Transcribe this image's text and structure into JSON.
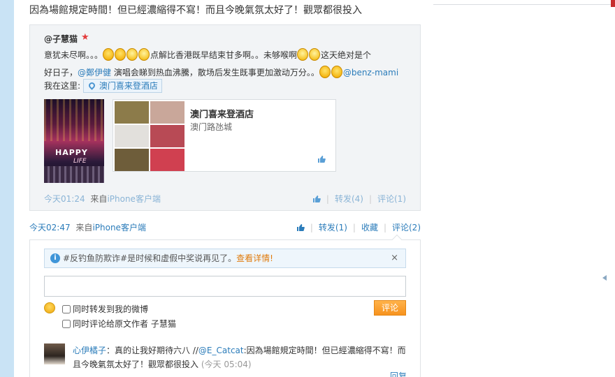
{
  "main_post": {
    "text": "因為場館規定時間！但已經濃縮得不寫！而且今晚氣氛太好了！觀眾都很投入"
  },
  "quoted_post": {
    "author": "@子慧猫",
    "line1_a": "意犹未尽啊。。。",
    "line1_b": "点解比香港既早结束甘多啊。。未够喉啊",
    "line1_c": "这天绝对是个",
    "line2_a": "好日子，",
    "mention_1": "@鄭伊健",
    "line2_b": " 演唱会睇到热血沸騰，散场后发生既事更加激动万分。。",
    "mention_2": "@benz-mami",
    "line3_prefix": "我在这里:",
    "location_chip": "澳门喜来登酒店",
    "place_card": {
      "name": "澳门喜来登酒店",
      "address": "澳门路氹城"
    },
    "concert_photo": {
      "text_happy": "HAPPY",
      "text_life": "LIFE"
    },
    "time": "今天01:24",
    "source_prefix": "来自",
    "source": "iPhone客户端",
    "forward": "转发(4)",
    "comment": "评论(1)"
  },
  "main_footer": {
    "time": "今天02:47",
    "source_prefix": "来自",
    "source": "iPhone客户端",
    "forward": "转发(1)",
    "favorite": "收藏",
    "comment": "评论(2)"
  },
  "comment_panel": {
    "notice_text": "#反钓鱼防欺诈#是时候和虚假中奖说再见了。",
    "notice_link": "查看详情!",
    "notice_close": "×",
    "input_value": "",
    "check_forward": "同时转发到我的微博",
    "check_comment_original": "同时评论给原文作者 子慧猫",
    "submit_label": "评论"
  },
  "comment": {
    "name": "心伊橘子",
    "text_a": "：真的让我好期待六八 //",
    "mention": "@E_Catcat",
    "text_b": ":因為場館規定時間！但已經濃縮得不寫！而且今晚氣氛太好了！觀眾都很投入",
    "time": "(今天 05:04)",
    "reply": "回复"
  },
  "icons": {
    "vip": "vip-star-icon",
    "like": "thumb-up-icon",
    "location": "location-pin-icon",
    "info": "info-icon",
    "close": "close-icon",
    "smiley": "smiley-icon"
  },
  "colors": {
    "link": "#2b7cba",
    "accent_orange": "#f7931e",
    "quote_bg": "#f2f4f6",
    "left_bar": "#c9e3f5"
  }
}
